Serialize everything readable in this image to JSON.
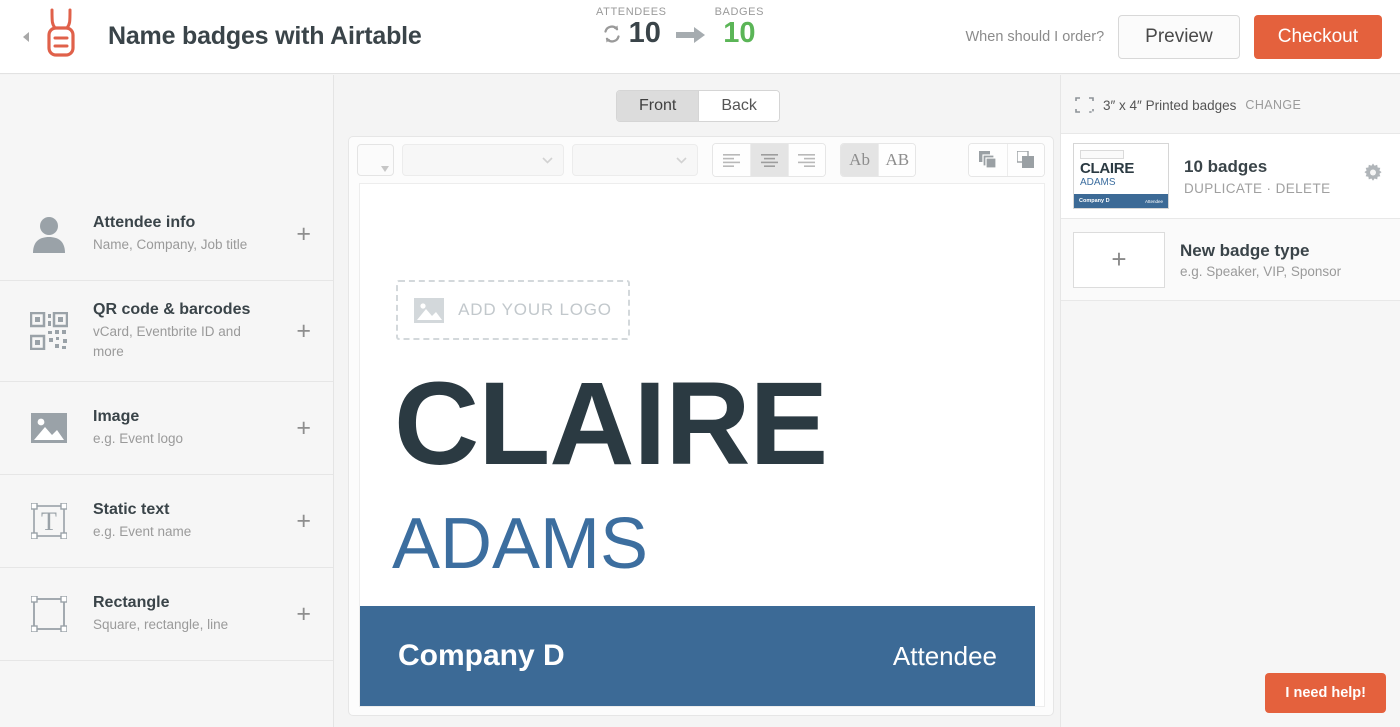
{
  "header": {
    "back_icon": "chevron-left-icon",
    "logo_icon": "badge-lanyard-logo",
    "title": "Name badges with Airtable",
    "counters": {
      "attendees_label": "ATTENDEES",
      "attendees_value": "10",
      "sync_icon": "sync-icon",
      "arrow_icon": "arrow-right-icon",
      "badges_label": "BADGES",
      "badges_value": "10",
      "badges_color": "#5bb557"
    },
    "when_order_link": "When should I order?",
    "preview_label": "Preview",
    "checkout_label": "Checkout",
    "checkout_color": "#e4613d"
  },
  "side_tabs": {
    "front": "Front",
    "back": "Back",
    "active": "Front"
  },
  "sidebar": {
    "items": [
      {
        "icon": "person-icon",
        "title": "Attendee info",
        "subtitle": "Name, Company, Job title",
        "add": "+"
      },
      {
        "icon": "qr-code-icon",
        "title": "QR code & barcodes",
        "subtitle": "vCard, Eventbrite ID and more",
        "add": "+"
      },
      {
        "icon": "image-icon",
        "title": "Image",
        "subtitle": "e.g. Event logo",
        "add": "+"
      },
      {
        "icon": "static-text-icon",
        "title": "Static text",
        "subtitle": "e.g. Event name",
        "add": "+"
      },
      {
        "icon": "rectangle-icon",
        "title": "Rectangle",
        "subtitle": "Square, rectangle, line",
        "add": "+"
      }
    ]
  },
  "toolbar": {
    "color_swatch": "",
    "font_family_value": "",
    "font_size_value": "",
    "align_left_icon": "align-left-icon",
    "align_center_icon": "align-center-icon",
    "align_right_icon": "align-right-icon",
    "align_active": "center",
    "case_mixed_label": "Ab",
    "case_upper_label": "AB",
    "case_active": "Ab",
    "bring_front_icon": "bring-to-front-icon",
    "send_back_icon": "send-to-back-icon"
  },
  "canvas": {
    "logo_placeholder_text": "ADD YOUR LOGO",
    "logo_placeholder_icon": "image-icon",
    "first_name": "CLAIRE",
    "last_name": "ADAMS",
    "company": "Company D",
    "role": "Attendee",
    "first_name_color": "#2b3a42",
    "last_name_color": "#3c6e9f",
    "bar_color": "#3c6a96"
  },
  "right_panel": {
    "size_icon": "badge-size-icon",
    "size_text": "3″ x 4″ Printed badges",
    "size_change_label": "CHANGE",
    "badge_type": {
      "count_label": "10 badges",
      "duplicate_label": "DUPLICATE",
      "separator": "·",
      "delete_label": "DELETE",
      "gear_icon": "gear-icon",
      "thumb_first_name": "CLAIRE",
      "thumb_last_name": "ADAMS",
      "thumb_company": "Company D",
      "thumb_role": "Attendee"
    },
    "new_badge_type": {
      "plus": "+",
      "title": "New badge type",
      "subtitle": "e.g. Speaker, VIP, Sponsor"
    }
  },
  "help_button": {
    "label": "I need help!",
    "color": "#e4613d"
  }
}
